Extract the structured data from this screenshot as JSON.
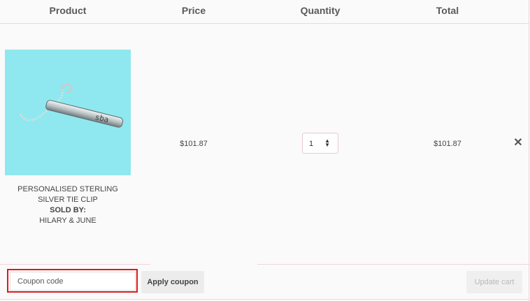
{
  "cart": {
    "headers": {
      "product": "Product",
      "price": "Price",
      "quantity": "Quantity",
      "total": "Total"
    },
    "item": {
      "name_line1": "PERSONALISED STERLING",
      "name_line2": "SILVER TIE CLIP",
      "sold_by_label": "SOLD BY:",
      "vendor": "HILARY & JUNE",
      "price": "$101.87",
      "quantity": "1",
      "total": "$101.87",
      "remove_icon": "close-x-icon"
    },
    "coupon": {
      "placeholder": "Coupon code",
      "apply_label": "Apply coupon"
    },
    "update_label": "Update cart"
  },
  "colors": {
    "border_pink": "#eed5df",
    "highlight_red": "#e21818",
    "product_bg": "#8fe8ef"
  }
}
